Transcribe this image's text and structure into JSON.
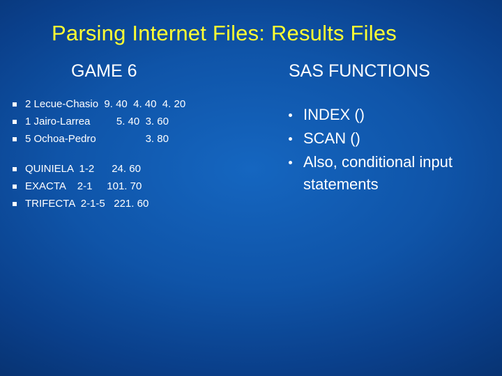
{
  "title": "Parsing Internet Files: Results Files",
  "left": {
    "heading": "GAME 6",
    "results": [
      "2 Lecue-Chasio  9. 40  4. 40  4. 20",
      "1 Jairo-Larrea         5. 40  3. 60",
      "5 Ochoa-Pedro                 3. 80"
    ],
    "bets": [
      "QUINIELA  1-2      24. 60",
      "EXACTA    2-1     101. 70",
      "TRIFECTA  2-1-5   221. 60"
    ]
  },
  "right": {
    "heading": "SAS FUNCTIONS",
    "items": [
      "INDEX ()",
      "SCAN ()",
      "Also, conditional input statements"
    ]
  }
}
